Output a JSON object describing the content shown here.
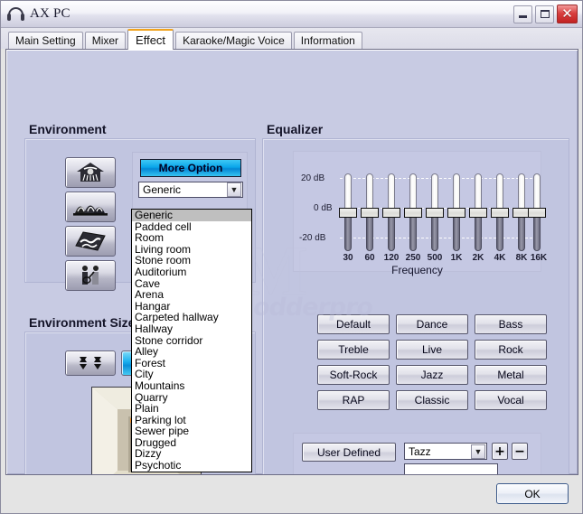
{
  "window": {
    "title": "AX PC",
    "icon": "headphone-icon",
    "buttons": {
      "minimize": "minimize-icon",
      "maximize": "maximize-icon",
      "close": "close-icon",
      "close_glyph": "✕"
    }
  },
  "tabs": [
    {
      "label": "Main Setting",
      "active": false
    },
    {
      "label": "Mixer",
      "active": false
    },
    {
      "label": "Effect",
      "active": true
    },
    {
      "label": "Karaoke/Magic Voice",
      "active": false
    },
    {
      "label": "Information",
      "active": false
    }
  ],
  "watermark": {
    "text": "modderpro",
    "mark": "M"
  },
  "environment": {
    "title": "Environment",
    "more_option_label": "More Option",
    "combo_value": "Generic",
    "combo_arrow": "chevron-down-icon",
    "preset_icons": [
      {
        "name": "bathroom-shower-icon"
      },
      {
        "name": "concert-hall-icon"
      },
      {
        "name": "water-surface-icon"
      },
      {
        "name": "live-band-icon"
      }
    ],
    "options": [
      "Generic",
      "Padded cell",
      "Room",
      "Living room",
      "Stone room",
      "Auditorium",
      "Cave",
      "Arena",
      "Hangar",
      "Carpeted hallway",
      "Hallway",
      "Stone corridor",
      "Alley",
      "Forest",
      "City",
      "Mountains",
      "Quarry",
      "Plain",
      "Parking lot",
      "Sewer pipe",
      "Drugged",
      "Dizzy",
      "Psychotic"
    ],
    "selected_option": "Generic"
  },
  "environment_size": {
    "title": "Environment Size",
    "buttons": [
      {
        "name": "expand-size-icon",
        "selected": false
      },
      {
        "name": "shrink-size-icon",
        "selected": true
      }
    ],
    "preview": "room-perspective-preview"
  },
  "equalizer": {
    "title": "Equalizer",
    "axis_labels": {
      "top": "20 dB",
      "mid": "0 dB",
      "bottom": "-20 dB"
    },
    "frequency_caption": "Frequency",
    "presets": [
      "Default",
      "Dance",
      "Bass",
      "Treble",
      "Live",
      "Rock",
      "Soft-Rock",
      "Jazz",
      "Metal",
      "RAP",
      "Classic",
      "Vocal"
    ],
    "user_defined": {
      "button_label": "User  Defined",
      "combo_value": "Tazz",
      "combo_arrow": "chevron-down-icon",
      "add_label": "+",
      "remove_label": "−",
      "name_input_value": "",
      "name_input_placeholder": ""
    }
  },
  "chart_data": {
    "type": "bar",
    "title": "Equalizer",
    "xlabel": "Frequency",
    "ylabel": "dB",
    "categories": [
      "30",
      "60",
      "120",
      "250",
      "500",
      "1K",
      "2K",
      "4K",
      "8K",
      "16K"
    ],
    "values": [
      0,
      0,
      0,
      0,
      0,
      0,
      0,
      0,
      0,
      0
    ],
    "ylim": [
      -20,
      20
    ],
    "yticks": [
      20,
      0,
      -20
    ],
    "ytick_labels": [
      "20 dB",
      "0 dB",
      "-20 dB"
    ],
    "grid": true,
    "legend": false
  },
  "footer": {
    "ok_label": "OK"
  },
  "colors": {
    "panel_bg": "#c8cbe3",
    "group_bg": "#c1c5e0",
    "accent_blue": "#0aa6ea",
    "tab_active_top": "#f0a420",
    "close_red": "#c22222"
  }
}
